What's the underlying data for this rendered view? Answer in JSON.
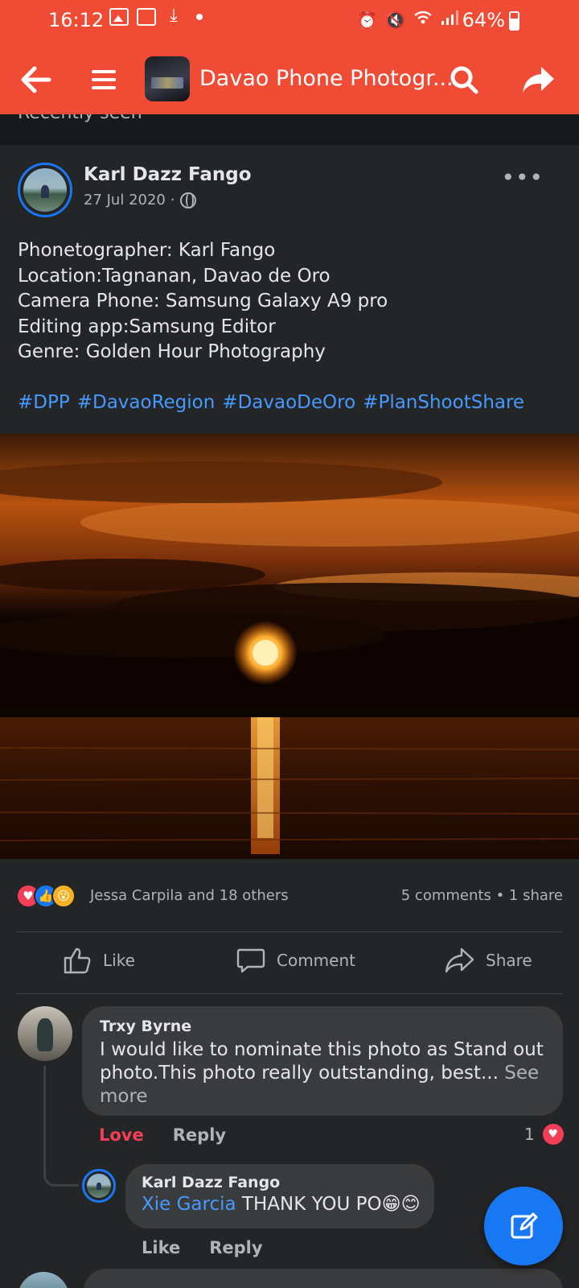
{
  "status_bar": {
    "time": "16:12",
    "battery": "64%",
    "battery_level": 0.64,
    "left_icons": [
      "image-notification-icon",
      "keyboard-notification-icon",
      "download-icon",
      "dot-icon"
    ],
    "right_icons": [
      "alarm-icon",
      "mute-icon",
      "wifi-icon",
      "signal-icon",
      "battery-icon"
    ]
  },
  "app_bar": {
    "group_title": "Davao Phone Photogr...",
    "icons": [
      "back-arrow-icon",
      "menu-icon",
      "search-icon",
      "share-arrow-icon"
    ],
    "background_color": "#f04b35"
  },
  "recently_seen_label": "Recently seen",
  "post": {
    "author": "Karl Dazz Fango",
    "date": "27 Jul 2020",
    "separator": "·",
    "more_label": "•••",
    "body_lines": [
      "Phonetographer: Karl Fango",
      "Location:Tagnanan, Davao de Oro",
      "Camera Phone: Samsung Galaxy A9 pro",
      "Editing app:Samsung Editor",
      "Genre: Golden Hour Photography"
    ],
    "hashtags": [
      "#DPP",
      "#DavaoRegion",
      "#DavaoDeOro",
      "#PlanShootShare"
    ],
    "reactions_text": "Jessa Carpila and 18 others",
    "reaction_icons": [
      "love-reaction-icon",
      "like-reaction-icon",
      "wow-reaction-icon"
    ],
    "comments_count": "5 comments",
    "share_count": "1 share",
    "count_separator": "•",
    "actions": {
      "like": "Like",
      "comment": "Comment",
      "share": "Share"
    }
  },
  "comments": [
    {
      "name": "Trxy Byrne",
      "text_lines": [
        "I would like to nominate this photo as Stand out",
        "photo.This photo really outstanding, best..."
      ],
      "see_more": "See more",
      "see_more_parts": [
        "See",
        "more"
      ],
      "love_label": "Love",
      "reply_label": "Reply",
      "love_count": "1"
    },
    {
      "name": "Karl Dazz Fango",
      "mention": "Xie Garcia",
      "text": "THANK YOU PO",
      "emoji": "😁😊",
      "like_label": "Like",
      "reply_label": "Reply"
    }
  ],
  "colors": {
    "accent": "#1877f2",
    "love": "#f33e58",
    "hashtag": "#4599ff",
    "background": "#242526"
  }
}
